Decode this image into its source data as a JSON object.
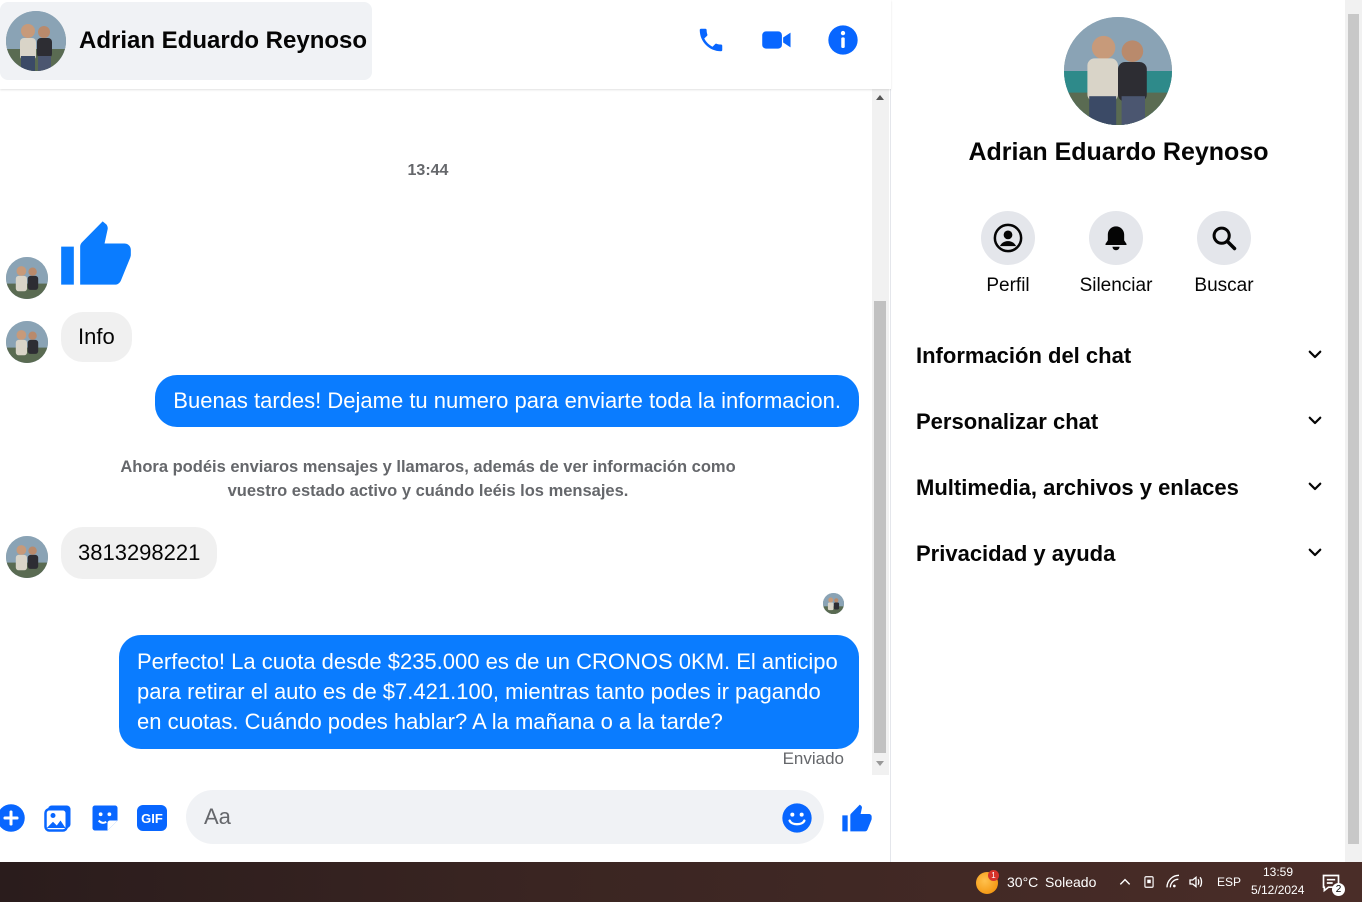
{
  "chat": {
    "contact_name": "Adrian Eduardo Reynoso",
    "header_icons": [
      "phone-icon",
      "video-icon",
      "info-icon"
    ],
    "time_separator": "13:44",
    "messages": {
      "in_info": "Info",
      "out_greeting": "Buenas tardes! Dejame tu numero para enviarte toda la informacion.",
      "system_note_line1": "Ahora podéis enviaros mensajes y llamaros, además de ver información como",
      "system_note_line2": "vuestro estado activo y cuándo leéis los mensajes.",
      "in_number": "3813298221",
      "out_offer_line1": "Perfecto! La cuota desde $235.000 es de un CRONOS 0KM. El anticipo",
      "out_offer_line2": "para retirar el auto es de $7.421.100, mientras tanto podes ir pagando",
      "out_offer_line3": "en cuotas. Cuándo podes hablar? A la mañana o a la tarde?",
      "status": "Enviado"
    },
    "composer": {
      "placeholder": "Aa",
      "icons": [
        "plus-icon",
        "image-icon",
        "sticker-icon",
        "gif-icon",
        "emoji-icon",
        "like-icon"
      ],
      "gif_label": "GIF"
    }
  },
  "info_panel": {
    "name": "Adrian Eduardo Reynoso",
    "actions": [
      {
        "label": "Perfil",
        "icon": "profile-icon"
      },
      {
        "label": "Silenciar",
        "icon": "bell-icon"
      },
      {
        "label": "Buscar",
        "icon": "search-icon"
      }
    ],
    "sections": [
      {
        "label": "Información del chat"
      },
      {
        "label": "Personalizar chat"
      },
      {
        "label": "Multimedia, archivos y enlaces"
      },
      {
        "label": "Privacidad y ayuda"
      }
    ]
  },
  "taskbar": {
    "weather": "30°C",
    "weather_desc": "Soleado",
    "weather_badge": "1",
    "language": "ESP",
    "time": "13:59",
    "date": "5/12/2024",
    "notification_count": "2"
  },
  "colors": {
    "accent": "#0a7cff",
    "bubble_in": "#f0f0f0",
    "icon_blue": "#0866ff"
  }
}
